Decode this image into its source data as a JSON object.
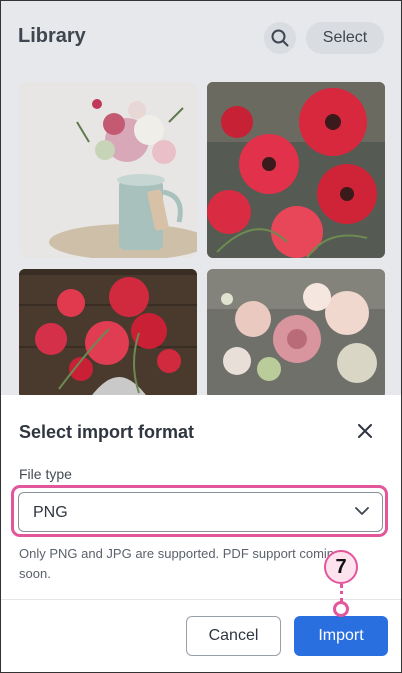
{
  "library": {
    "title": "Library",
    "select_label": "Select",
    "search_icon": "search-icon"
  },
  "photos": [
    {
      "subject": "pink roses and peonies in a teal jug",
      "bg": "#e9e6e4"
    },
    {
      "subject": "red poppies close-up",
      "bg": "#5a5d55"
    },
    {
      "subject": "red poppies in glass vase",
      "bg": "#4b3b30"
    },
    {
      "subject": "pink ranunculus bouquet",
      "bg": "#6f6f66"
    }
  ],
  "sheet": {
    "title": "Select import format",
    "close_icon": "close-icon",
    "file_type_label": "File type",
    "file_type_value": "PNG",
    "chevron_icon": "chevron-down-icon",
    "helper_text": "Only PNG and JPG are supported. PDF support coming soon.",
    "cancel_label": "Cancel",
    "import_label": "Import"
  },
  "step_marker": {
    "number": "7",
    "color": "#e2569b"
  },
  "colors": {
    "primary": "#2a6fe0",
    "highlight": "#e2569b"
  }
}
